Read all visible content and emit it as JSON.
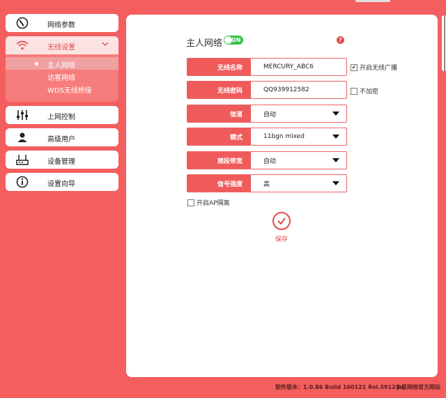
{
  "sidebar": {
    "items": [
      {
        "label": "网络参数",
        "icon": "globe-icon"
      },
      {
        "label": "无线设置",
        "icon": "wifi-icon"
      },
      {
        "label": "上网控制",
        "icon": "sliders-icon"
      },
      {
        "label": "高级用户",
        "icon": "user-icon"
      },
      {
        "label": "设备管理",
        "icon": "router-icon"
      },
      {
        "label": "设置向导",
        "icon": "info-icon"
      }
    ],
    "subitems": [
      {
        "label": "主人网络"
      },
      {
        "label": "访客网络"
      },
      {
        "label": "WDS无线桥接"
      }
    ]
  },
  "main": {
    "title": "主人网络",
    "toggle": "ON",
    "help": "?",
    "fields": [
      {
        "label": "无线名称",
        "value": "MERCURY_ABC6"
      },
      {
        "label": "无线密码",
        "value": "QQ939912582"
      },
      {
        "label": "信道",
        "value": "自动"
      },
      {
        "label": "模式",
        "value": "11bgn mixed"
      },
      {
        "label": "频段带宽",
        "value": "自动"
      },
      {
        "label": "信号强度",
        "value": "高"
      }
    ],
    "broadcast_label": "开启无线广播",
    "broadcast_checked": true,
    "noencrypt_label": "不加密",
    "ap_isolation_label": "开启AP隔离",
    "save_label": "保存"
  },
  "footer": {
    "version": "软件版本：1.0.86 Build 160121 Rel.59121n",
    "site": "水星网络官方网站"
  },
  "colors": {
    "accent": "#f45e5e",
    "label_bg": "#ef5a5a",
    "toggle": "#39c24a"
  }
}
